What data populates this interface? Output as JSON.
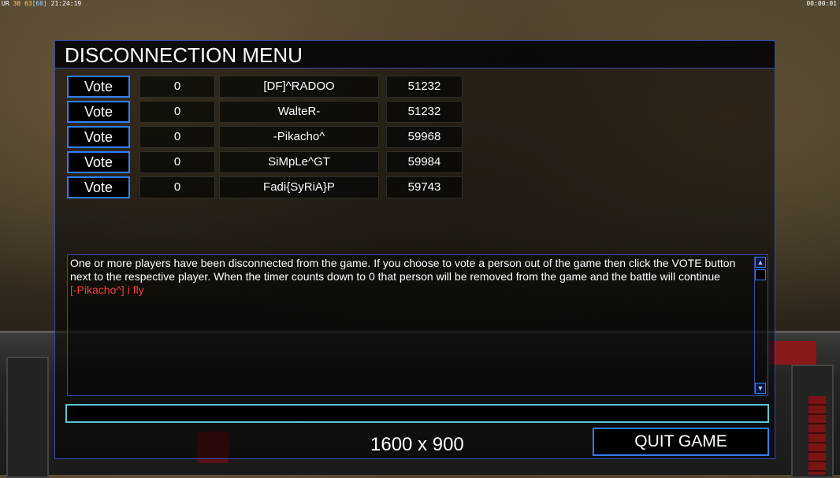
{
  "hud": {
    "left_prefix": "UR",
    "left_a": "30",
    "left_b": "63",
    "left_c": "[60]",
    "clock": "21:24:19",
    "timer": "00:00:01"
  },
  "dialog": {
    "title": "DISCONNECTION MENU",
    "vote_label": "Vote",
    "players": [
      {
        "votes": "0",
        "name": "[DF]^RADOO",
        "ping": "51232"
      },
      {
        "votes": "0",
        "name": "WalteR-",
        "ping": "51232"
      },
      {
        "votes": "0",
        "name": "-Pikacho^",
        "ping": "59968"
      },
      {
        "votes": "0",
        "name": "SiMpLe^GT",
        "ping": "59984"
      },
      {
        "votes": "0",
        "name": "Fadi{SyRiA}P",
        "ping": "59743"
      }
    ],
    "message": "One or more players have been disconnected from the game. If you choose to vote a person out of the game then click the VOTE button next to the respective player. When the timer counts down to 0 that person will be removed from the game and the battle will continue",
    "chat_line": "[-Pikacho^] i fly",
    "chat_input_value": "",
    "resolution_text": "1600 x 900",
    "quit_label": "QUIT GAME"
  },
  "icons": {
    "scroll_up": "scroll-up-icon",
    "scroll_down": "scroll-down-icon"
  },
  "colors": {
    "accent_blue": "#2f7fff",
    "chat_red": "#ff3b3b",
    "input_border": "#5ac8d8"
  }
}
